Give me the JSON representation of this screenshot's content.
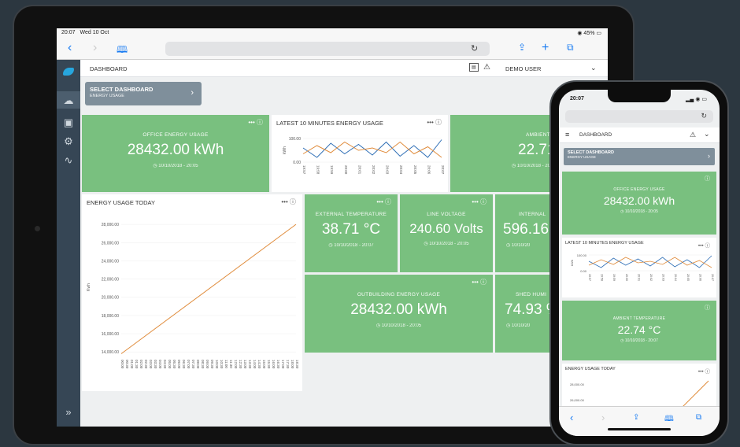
{
  "ipad": {
    "status": {
      "time": "20:07",
      "date": "Wed 10 Oct",
      "battery": "45%"
    },
    "topbar": {
      "title": "DASHBOARD",
      "user": "DEMO USER"
    },
    "select_dashboard": {
      "label": "SELECT DASHBOARD",
      "sub": "ENERGY USAGE"
    },
    "tiles": {
      "office": {
        "title": "OFFICE ENERGY USAGE",
        "value": "28432.00 kWh",
        "time": "10/10/2018 - 20:05"
      },
      "ambient": {
        "title": "AMBIENT TEMPERATU",
        "value": "22.71 °C",
        "time": "10/10/2018 - 20"
      },
      "external": {
        "title": "EXTERNAL TEMPERATURE",
        "value": "38.71 °C",
        "time": "10/10/2018 - 20:07"
      },
      "line": {
        "title": "LINE VOLTAGE",
        "value": "240.60 Volts",
        "time": "10/10/2018 - 20:05"
      },
      "internal": {
        "title": "INTERNAL",
        "value": "596.16",
        "time": "10/10/20"
      },
      "outbuilding": {
        "title": "OUTBUILDING ENERGY USAGE",
        "value": "28432.00 kWh",
        "time": "10/10/2018 - 20:05"
      },
      "humidity": {
        "title": "SHED HUMI",
        "value": "74.93 %",
        "time": "10/10/20"
      }
    },
    "latest_chart_title": "LATEST 10 MINUTES ENERGY USAGE",
    "today_chart_title": "ENERGY USAGE TODAY"
  },
  "iphone": {
    "status": {
      "time": "20:07"
    },
    "topbar": {
      "title": "DASHBOARD"
    },
    "select_dashboard": {
      "label": "SELECT DASHBOARD",
      "sub": "ENERGY USAGE"
    },
    "office": {
      "title": "OFFICE ENERGY USAGE",
      "value": "28432.00 kWh",
      "time": "10/10/2018 - 20:05"
    },
    "latest_chart_title": "LATEST 10 MINUTES ENERGY USAGE",
    "ambient": {
      "title": "AMBIENT TEMPERATURE",
      "value": "22.74 °C",
      "time": "10/10/2018 - 20:07"
    },
    "today_chart_title": "ENERGY USAGE TODAY",
    "today_ticks": [
      "28,000.00",
      "26,000.00"
    ]
  },
  "chart_data": [
    {
      "type": "line",
      "title": "LATEST 10 MINUTES ENERGY USAGE",
      "ylabel": "kWh",
      "ylim": [
        0,
        100
      ],
      "yticks": [
        "100.00",
        "0.00"
      ],
      "x": [
        "19:57",
        "19:58",
        "19:59",
        "20:00",
        "20:01",
        "20:02",
        "20:03",
        "20:04",
        "20:05",
        "20:06",
        "20:07"
      ],
      "series": [
        {
          "color": "#2f6fb6",
          "values": [
            60,
            20,
            80,
            35,
            75,
            30,
            85,
            25,
            70,
            20,
            95
          ]
        },
        {
          "color": "#e08c3c",
          "values": [
            35,
            70,
            40,
            85,
            50,
            60,
            40,
            85,
            35,
            65,
            20
          ]
        }
      ]
    },
    {
      "type": "line",
      "title": "ENERGY USAGE TODAY",
      "ylabel": "Kwh",
      "ylim": [
        13500,
        28700
      ],
      "yticks": [
        14000,
        16000,
        18000,
        20000,
        22000,
        24000,
        26000,
        28000
      ],
      "ytick_labels": [
        "14,000.00",
        "16,000.00",
        "18,000.00",
        "20,000.00",
        "22,000.00",
        "24,000.00",
        "26,000.00",
        "28,000.00"
      ],
      "x": [
        "00:00",
        "00:30",
        "01:00",
        "01:30",
        "02:00",
        "02:30",
        "03:00",
        "03:30",
        "04:00",
        "04:30",
        "05:00",
        "05:30",
        "06:00",
        "06:30",
        "07:00",
        "07:30",
        "08:00",
        "08:30",
        "09:00",
        "09:30",
        "10:00",
        "10:30",
        "11:00",
        "11:30",
        "12:00",
        "12:30",
        "13:00",
        "13:30",
        "14:00",
        "14:30",
        "15:00",
        "15:30",
        "16:00",
        "16:30",
        "17:00",
        "17:30",
        "18:00",
        "18:30"
      ],
      "series": [
        {
          "color": "#e08c3c",
          "values": [
            13800,
            28000
          ]
        }
      ]
    }
  ]
}
